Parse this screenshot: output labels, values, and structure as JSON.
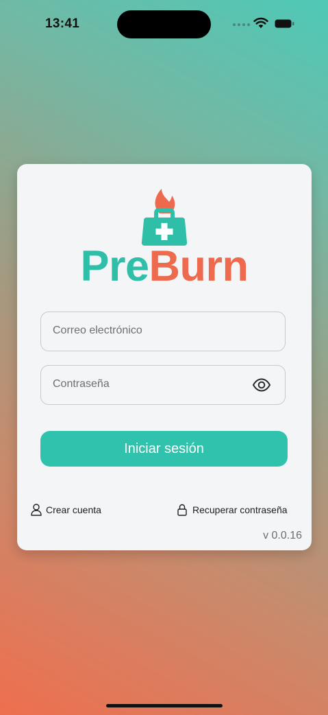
{
  "status_bar": {
    "time": "13:41"
  },
  "brand": {
    "name_part1": "Pre",
    "name_part2": "Burn",
    "primary_color": "#2fbfa8",
    "secondary_color": "#ee6a4f"
  },
  "form": {
    "email_placeholder": "Correo electrónico",
    "password_placeholder": "Contraseña",
    "login_label": "Iniciar sesión"
  },
  "links": {
    "create_account": "Crear cuenta",
    "recover_password": "Recuperar contraseña"
  },
  "version": "v 0.0.16",
  "icons": {
    "logo": "medical-bag-flame-icon",
    "password_toggle": "eye-icon",
    "create_account": "user-icon",
    "recover_password": "lock-icon"
  }
}
